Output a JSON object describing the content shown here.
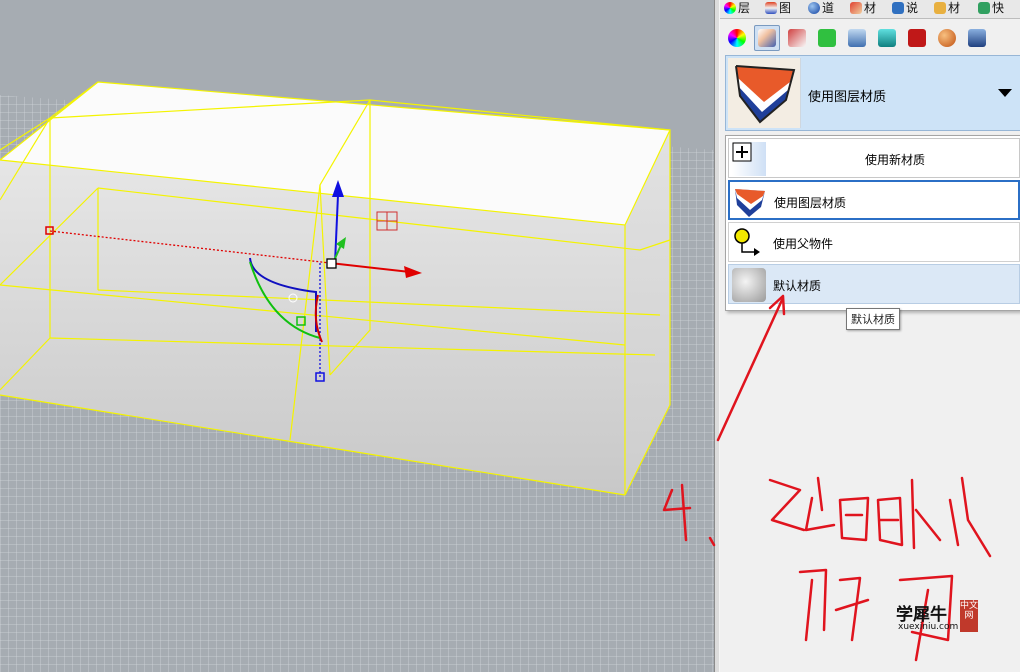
{
  "panel": {
    "tabs": [
      {
        "label": "层",
        "icon": "color-wheel-icon"
      },
      {
        "label": "图",
        "icon": "layer-icon"
      },
      {
        "label": "道",
        "icon": "sphere-icon"
      },
      {
        "label": "材",
        "icon": "brush-icon"
      },
      {
        "label": "说",
        "icon": "notes-icon"
      },
      {
        "label": "材",
        "icon": "folder-icon"
      },
      {
        "label": "快",
        "icon": "snapshot-icon"
      }
    ],
    "toolbar_icons": [
      "color-wheel-icon",
      "material-brush-icon",
      "decal-icon",
      "texture-map-icon",
      "shade-icon",
      "cylinder-icon",
      "render-settings-icon",
      "sphere-texture-icon",
      "object-props-icon"
    ],
    "material_select": {
      "label": "使用图层材质",
      "icon": "layer-material-icon"
    },
    "dropdown": [
      {
        "label": "使用新材质",
        "icon": "plus-icon"
      },
      {
        "label": "使用图层材质",
        "icon": "layer-material-icon"
      },
      {
        "label": "使用父物件",
        "icon": "parent-object-icon"
      },
      {
        "label": "默认材质",
        "icon": "default-material-icon"
      }
    ],
    "tooltip": "默认材质"
  },
  "watermark": {
    "brand": "学犀牛",
    "url": "xuexiniu.com",
    "seal": "中文网"
  },
  "colors": {
    "selection_yellow": "#f4f400",
    "viewport_bg": "#a6acb2",
    "annotation_red": "#e0141e",
    "hover_blue": "#cde3f7"
  }
}
